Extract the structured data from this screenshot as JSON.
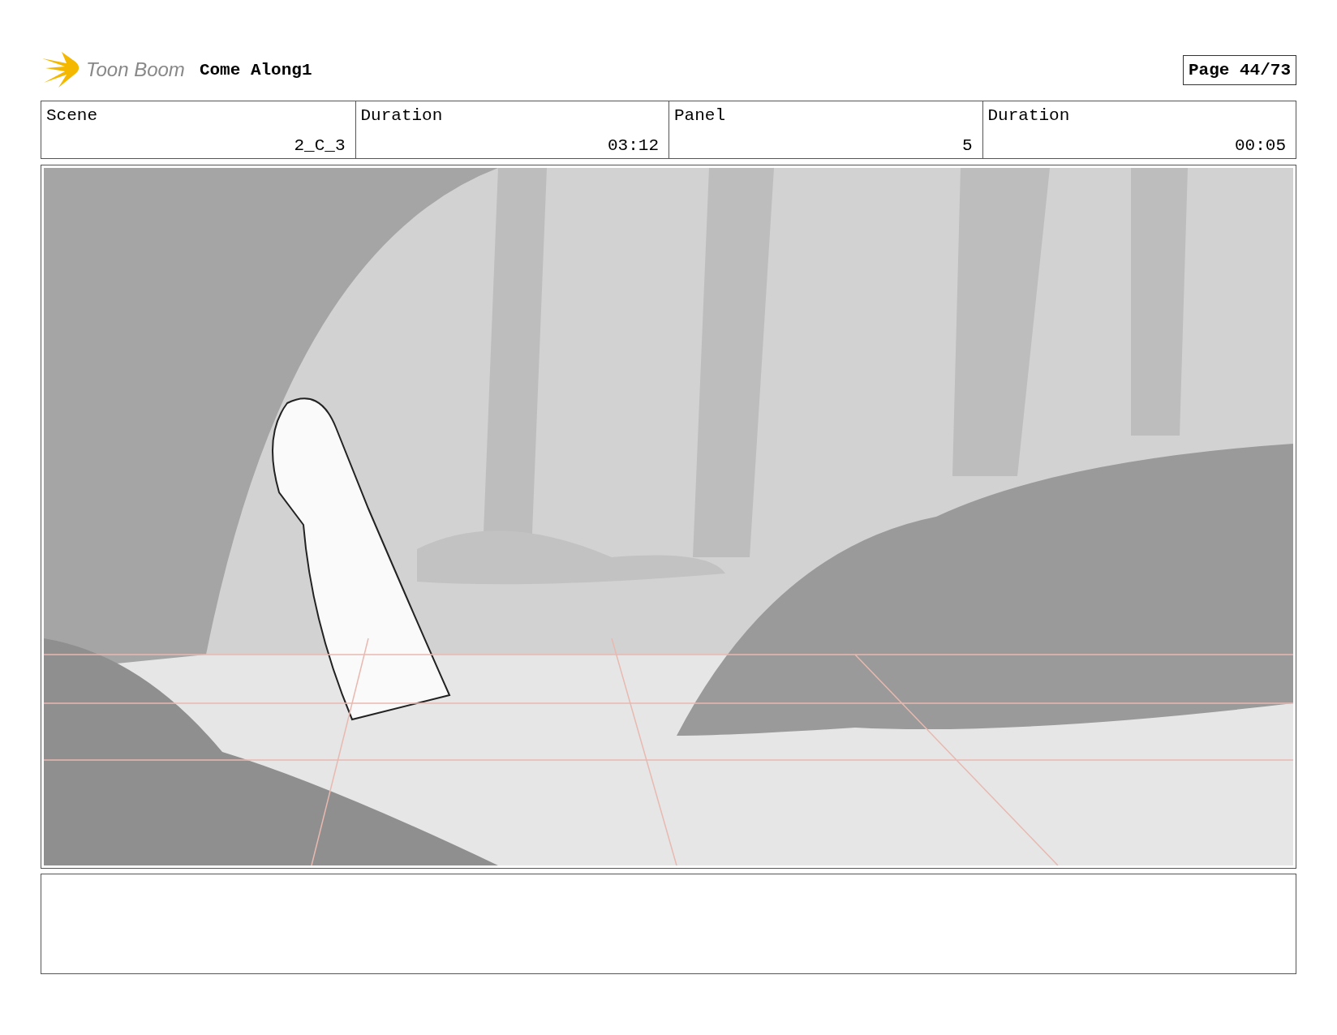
{
  "header": {
    "logo": "Toon Boom",
    "title": "Come Along1",
    "page": "Page 44/73"
  },
  "fields": [
    {
      "label": "Scene",
      "value": "2_C_3"
    },
    {
      "label": "Duration",
      "value": "03:12"
    },
    {
      "label": "Panel",
      "value": "5"
    },
    {
      "label": "Duration",
      "value": "00:05"
    }
  ]
}
